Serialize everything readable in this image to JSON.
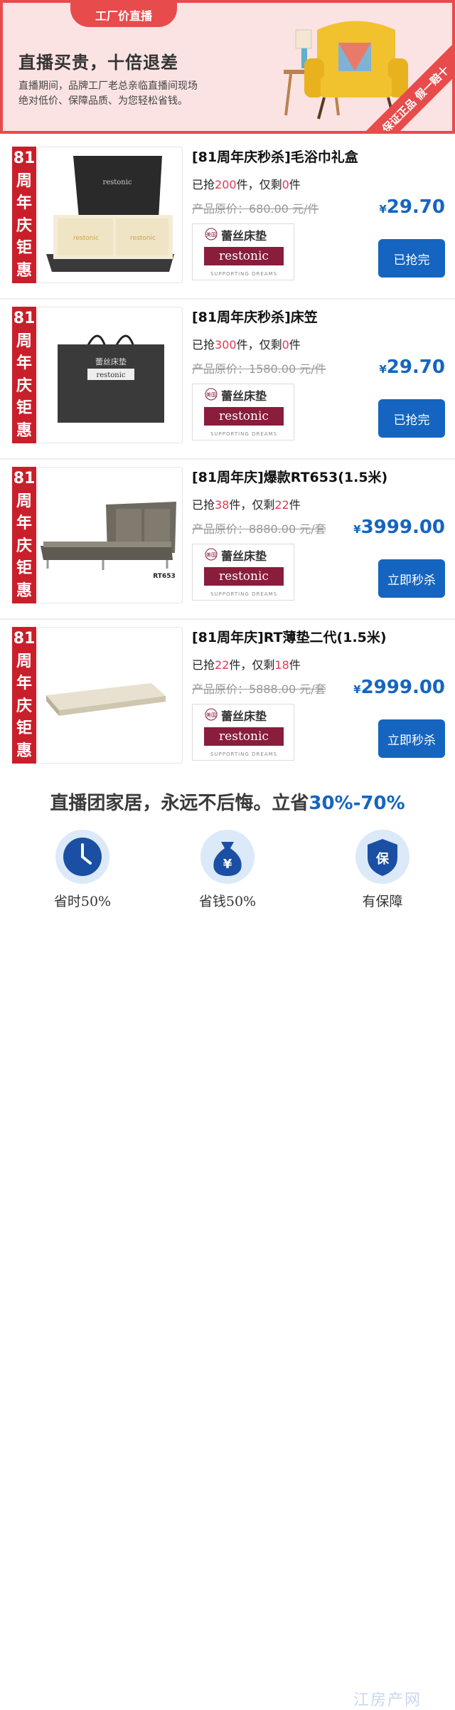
{
  "banner": {
    "tab": "工厂价直播",
    "title": "直播买贵，十倍退差",
    "line1": "直播期间，品牌工厂老总亲临直播间现场",
    "line2": "绝对低价、保障品质、为您轻松省钱。",
    "ribbon": "保证正品 假一赔十"
  },
  "tag_chars": [
    "81",
    "周",
    "年",
    "庆",
    "钜",
    "惠"
  ],
  "brand": {
    "cn": "蕾丝床垫",
    "logo": "restonic",
    "slogan": "SUPPORTING DREAMS",
    "tiny": "美国"
  },
  "items": [
    {
      "name": "[81周年庆秒杀]毛浴巾礼盒",
      "stock_pre": "已抢",
      "sold": "200",
      "stock_mid": "件，仅剩",
      "left": "0",
      "stock_post": "件",
      "orig": "产品原价：680.00 元/件",
      "currency": "¥",
      "price": "29.70",
      "button": "已抢完",
      "image": "towel-gift-box-image"
    },
    {
      "name": "[81周年庆秒杀]床笠",
      "stock_pre": "已抢",
      "sold": "300",
      "stock_mid": "件，仅剩",
      "left": "0",
      "stock_post": "件",
      "orig": "产品原价：1580.00 元/件",
      "currency": "¥",
      "price": "29.70",
      "button": "已抢完",
      "image": "gift-bag-image"
    },
    {
      "name": "[81周年庆]爆款RT653(1.5米)",
      "stock_pre": "已抢",
      "sold": "38",
      "stock_mid": "件，仅剩",
      "left": "22",
      "stock_post": "件",
      "orig": "产品原价：8880.00 元/套",
      "currency": "¥",
      "price": "3999.00",
      "button": "立即秒杀",
      "image": "bed-image",
      "model": "RT653"
    },
    {
      "name": "[81周年庆]RT薄垫二代(1.5米)",
      "stock_pre": "已抢",
      "sold": "22",
      "stock_mid": "件，仅剩",
      "left": "18",
      "stock_post": "件",
      "orig": "产品原价：5888.00 元/套",
      "currency": "¥",
      "price": "2999.00",
      "button": "立即秒杀",
      "image": "mattress-image"
    }
  ],
  "promo": {
    "text": "直播团家居，永远不后悔。立省",
    "accent": "30%-70%"
  },
  "features": [
    {
      "label": "省时50%",
      "icon": "clock-icon"
    },
    {
      "label": "省钱50%",
      "icon": "money-bag-icon"
    },
    {
      "label": "有保障",
      "icon": "shield-icon"
    }
  ],
  "watermark": "江房产网",
  "colors": {
    "red": "#c91f2a",
    "blue": "#1565c0",
    "banner": "#fbe3e3"
  }
}
